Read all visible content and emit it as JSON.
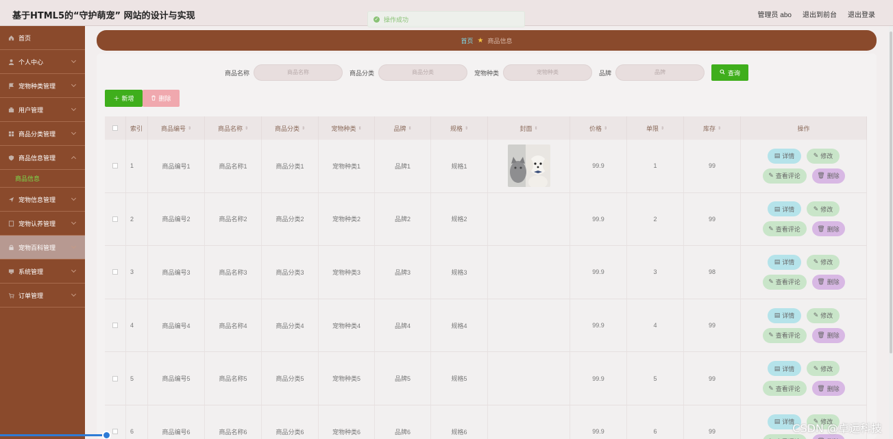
{
  "header": {
    "title": "基于HTML5的“守护萌宠” 网站的设计与实现",
    "admin_label": "管理员 abo",
    "back_label": "退出到前台",
    "logout_label": "退出登录"
  },
  "toast": {
    "text": "操作成功"
  },
  "sidebar": {
    "items": [
      {
        "label": "首页",
        "icon": "home-icon"
      },
      {
        "label": "个人中心",
        "icon": "user-icon"
      },
      {
        "label": "宠物种类管理",
        "icon": "flag-icon"
      },
      {
        "label": "用户管理",
        "icon": "users-icon"
      },
      {
        "label": "商品分类管理",
        "icon": "grid-icon"
      },
      {
        "label": "商品信息管理",
        "icon": "shield-icon"
      },
      {
        "label": "宠物信息管理",
        "icon": "send-icon"
      },
      {
        "label": "宠物认养管理",
        "icon": "doc-icon"
      },
      {
        "label": "宠物百科管理",
        "icon": "lock-icon"
      },
      {
        "label": "系统管理",
        "icon": "monitor-icon"
      },
      {
        "label": "订单管理",
        "icon": "cart-icon"
      }
    ],
    "sub_item": "商品信息"
  },
  "breadcrumb": {
    "home": "首页",
    "current": "商品信息"
  },
  "search": {
    "fields": [
      {
        "label": "商品名称",
        "placeholder": "商品名称"
      },
      {
        "label": "商品分类",
        "placeholder": "商品分类"
      },
      {
        "label": "宠物种类",
        "placeholder": "宠物种类"
      },
      {
        "label": "品牌",
        "placeholder": "品牌"
      }
    ],
    "query_label": "查询"
  },
  "actions": {
    "add_label": "新增",
    "delete_label": "删除"
  },
  "table": {
    "headers": [
      "索引",
      "商品编号",
      "商品名称",
      "商品分类",
      "宠物种类",
      "品牌",
      "规格",
      "封面",
      "价格",
      "单限",
      "库存",
      "操作"
    ],
    "op_labels": {
      "detail": "详情",
      "edit": "修改",
      "review": "查看评论",
      "delete": "删除"
    },
    "rows": [
      {
        "idx": "1",
        "code": "商品编号1",
        "name": "商品名称1",
        "cat": "商品分类1",
        "pet": "宠物种类1",
        "brand": "品牌1",
        "spec": "规格1",
        "price": "99.9",
        "limit": "1",
        "stock": "99"
      },
      {
        "idx": "2",
        "code": "商品编号2",
        "name": "商品名称2",
        "cat": "商品分类2",
        "pet": "宠物种类2",
        "brand": "品牌2",
        "spec": "规格2",
        "price": "99.9",
        "limit": "2",
        "stock": "99"
      },
      {
        "idx": "3",
        "code": "商品编号3",
        "name": "商品名称3",
        "cat": "商品分类3",
        "pet": "宠物种类3",
        "brand": "品牌3",
        "spec": "规格3",
        "price": "99.9",
        "limit": "3",
        "stock": "98"
      },
      {
        "idx": "4",
        "code": "商品编号4",
        "name": "商品名称4",
        "cat": "商品分类4",
        "pet": "宠物种类4",
        "brand": "品牌4",
        "spec": "规格4",
        "price": "99.9",
        "limit": "4",
        "stock": "99"
      },
      {
        "idx": "5",
        "code": "商品编号5",
        "name": "商品名称5",
        "cat": "商品分类5",
        "pet": "宠物种类5",
        "brand": "品牌5",
        "spec": "规格5",
        "price": "99.9",
        "limit": "5",
        "stock": "99"
      },
      {
        "idx": "6",
        "code": "商品编号6",
        "name": "商品名称6",
        "cat": "商品分类6",
        "pet": "宠物种类6",
        "brand": "品牌6",
        "spec": "规格6",
        "price": "99.9",
        "limit": "6",
        "stock": "99"
      }
    ]
  },
  "watermark": "CSDN @卓远科技",
  "colors": {
    "sidebar": "#8a4a2c",
    "accent_green": "#3fae1c",
    "delete_pink": "#f0a8ae"
  }
}
